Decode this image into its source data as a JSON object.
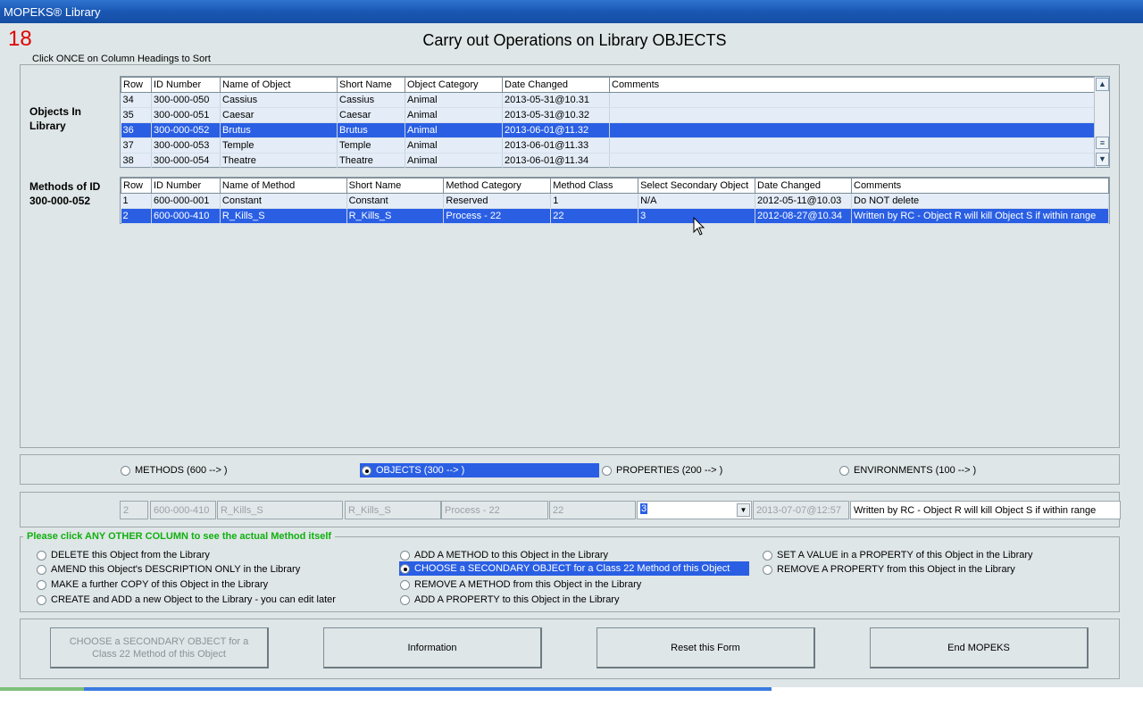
{
  "window": {
    "title": "MOPEKS® Library"
  },
  "form": {
    "number": "18",
    "title": "Carry out Operations on Library OBJECTS",
    "sort_hint": "Click ONCE on Column Headings to Sort"
  },
  "objects": {
    "label_line1": "Objects In",
    "label_line2": "Library",
    "columns": [
      "Row",
      "ID Number",
      "Name of Object",
      "Short Name",
      "Object Category",
      "Date Changed",
      "Comments"
    ],
    "rows": [
      [
        "34",
        "300-000-050",
        "Cassius",
        "Cassius",
        "Animal",
        "2013-05-31@10.31",
        ""
      ],
      [
        "35",
        "300-000-051",
        "Caesar",
        "Caesar",
        "Animal",
        "2013-05-31@10.32",
        ""
      ],
      [
        "36",
        "300-000-052",
        "Brutus",
        "Brutus",
        "Animal",
        "2013-06-01@11.32",
        ""
      ],
      [
        "37",
        "300-000-053",
        "Temple",
        "Temple",
        "Animal",
        "2013-06-01@11.33",
        ""
      ],
      [
        "38",
        "300-000-054",
        "Theatre",
        "Theatre",
        "Animal",
        "2013-06-01@11.34",
        ""
      ]
    ],
    "selected_row": 2
  },
  "methods": {
    "label_line1": "Methods of ID",
    "label_line2": "300-000-052",
    "columns": [
      "Row",
      "ID Number",
      "Name of Method",
      "Short Name",
      "Method Category",
      "Method Class",
      "Select Secondary Object",
      "Date Changed",
      "Comments"
    ],
    "rows": [
      [
        "1",
        "600-000-001",
        "Constant",
        "Constant",
        "Reserved",
        "1",
        "N/A",
        "2012-05-11@10.03",
        "Do NOT delete"
      ],
      [
        "2",
        "600-000-410",
        "R_Kills_S",
        "R_Kills_S",
        "Process - 22",
        "22",
        "3",
        "2012-08-27@10.34",
        "Written by RC - Object R will kill Object S if within range"
      ]
    ],
    "selected_row": 1
  },
  "type_options": {
    "methods": "METHODS (600 --> )",
    "objects": "OBJECTS (300 --> )",
    "properties": "PROPERTIES (200 --> )",
    "environments": "ENVIRONMENTS (100 --> )",
    "selected": "objects"
  },
  "edit_row": {
    "row": "2",
    "id": "600-000-410",
    "name": "R_Kills_S",
    "short_name": "R_Kills_S",
    "category": "Process - 22",
    "class": "22",
    "secondary": "3",
    "date": "2013-07-07@12:57",
    "comments": "Written by RC - Object R will kill Object S if within range"
  },
  "operations": {
    "legend": "Please click ANY OTHER COLUMN to see the actual Method itself",
    "delete": "DELETE this Object from the Library",
    "amend": "AMEND this Object's DESCRIPTION ONLY in the Library",
    "copy": "MAKE a further COPY of this Object in the Library",
    "create": "CREATE and ADD a new Object to the Library - you can edit later",
    "add_method": "ADD A METHOD to this Object in the Library",
    "choose_secondary": "CHOOSE a SECONDARY OBJECT for a Class 22 Method of this Object",
    "remove_method": "REMOVE A METHOD from this Object in the Library",
    "add_property": "ADD A PROPERTY to this Object in the Library",
    "set_value": "SET A VALUE in a PROPERTY of this Object in the Library",
    "remove_property": "REMOVE A PROPERTY from this Object in the Library",
    "selected": "choose_secondary"
  },
  "buttons": {
    "action_line1": "CHOOSE a SECONDARY OBJECT for a",
    "action_line2": "Class 22 Method of this Object",
    "information": "Information",
    "reset": "Reset this Form",
    "end": "End MOPEKS"
  },
  "colors": {
    "selection": "#2a5fe4",
    "titlebar": "#1a57b4",
    "form_number": "#e00000"
  }
}
